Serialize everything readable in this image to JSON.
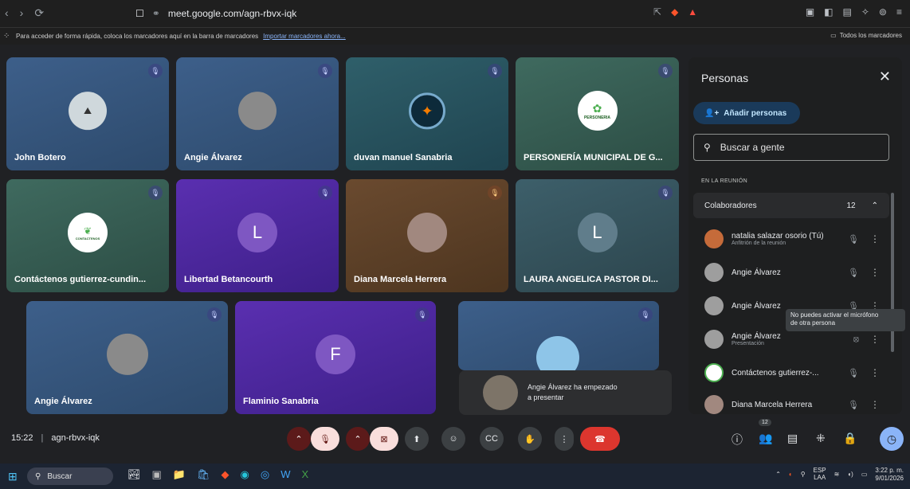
{
  "browser": {
    "url": "meet.google.com/agn-rbvx-iqk",
    "bookmarks_text": "Para acceder de forma rápida, coloca los marcadores aquí en la barra de marcadores",
    "bookmarks_link": "Importar marcadores ahora...",
    "all_bookmarks": "Todos los marcadores"
  },
  "tiles": [
    {
      "name": "John Botero",
      "initial": ""
    },
    {
      "name": "Angie Álvarez",
      "initial": ""
    },
    {
      "name": "duvan manuel Sanabria",
      "initial": ""
    },
    {
      "name": "PERSONERÍA MUNICIPAL DE G...",
      "initial": "",
      "logo_text": "PERSONERIA"
    },
    {
      "name": "Contáctenos gutierrez-cundin...",
      "initial": "",
      "logo_text": "CONTACTENOS"
    },
    {
      "name": "Libertad Betancourth",
      "initial": "L"
    },
    {
      "name": "Diana Marcela Herrera",
      "initial": ""
    },
    {
      "name": "LAURA ANGELICA PASTOR DI...",
      "initial": "L"
    },
    {
      "name": "Angie Álvarez",
      "initial": ""
    },
    {
      "name": "Flaminio Sanabria",
      "initial": "F"
    },
    {
      "name": "",
      "initial": ""
    }
  ],
  "toast": {
    "line1": "Angie Álvarez ha empezado",
    "line2": "a presentar"
  },
  "panel": {
    "title": "Personas",
    "add_label": "Añadir personas",
    "search_placeholder": "Buscar a gente",
    "section": "EN LA REUNIÓN",
    "group_label": "Colaboradores",
    "group_count": "12",
    "people": [
      {
        "name": "natalia salazar osorio (Tú)",
        "sub": "Anfitrión de la reunión"
      },
      {
        "name": "Angie Álvarez",
        "sub": ""
      },
      {
        "name": "Angie Álvarez",
        "sub": ""
      },
      {
        "name": "Angie Álvarez",
        "sub": "Presentación"
      },
      {
        "name": "Contáctenos gutierrez-...",
        "sub": ""
      },
      {
        "name": "Diana Marcela Herrera",
        "sub": ""
      }
    ],
    "tooltip_line1": "No puedes activar el micrófono",
    "tooltip_line2": "de otra persona"
  },
  "bottom": {
    "time": "15:22",
    "separator": "|",
    "meeting_code": "agn-rbvx-iqk",
    "participants_badge": "12"
  },
  "taskbar": {
    "search": "Buscar",
    "lang1": "ESP",
    "lang2": "LAA",
    "clock_time": "3:22 p. m.",
    "clock_date": "9/01/2026"
  }
}
